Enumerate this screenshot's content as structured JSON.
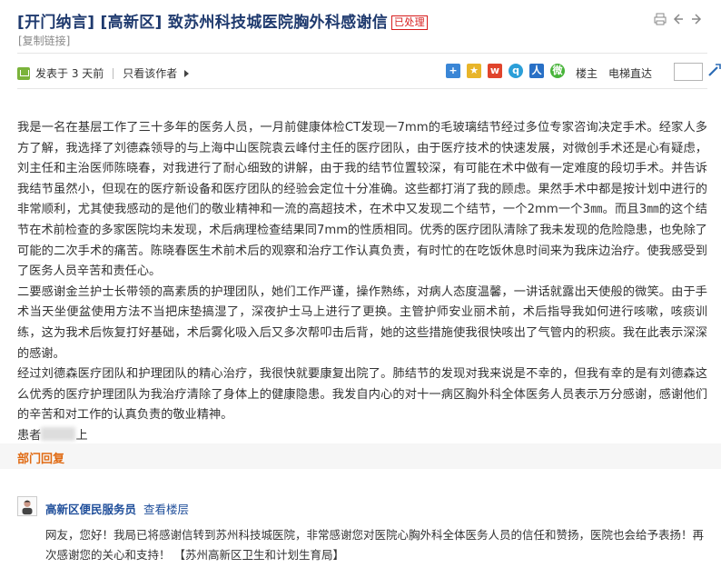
{
  "header": {
    "title": "[开门纳言] [高新区] 致苏州科技城医院胸外科感谢信",
    "status_tag": "已处理",
    "copy_link": "[复制链接]"
  },
  "meta": {
    "posted": "发表于 3 天前",
    "only_author": "只看该作者",
    "floor": "楼主",
    "elevator": "电梯直达"
  },
  "content": {
    "paragraphs": [
      "我是一名在基层工作了三十多年的医务人员，一月前健康体检CT发现一7mm的毛玻璃结节经过多位专家咨询决定手术。经家人多方了解，我选择了刘德森领导的与上海中山医院袁云峰付主任的医疗团队，由于医疗技术的快速发展，对微创手术还是心有疑虑，刘主任和主治医师陈晓春，对我进行了耐心细致的讲解，由于我的结节位置较深，有可能在术中做有一定难度的段切手术。并告诉我结节虽然小，但现在的医疗新设备和医疗团队的经验会定位十分准确。这些都打消了我的顾虑。果然手术中都是按计划中进行的非常顺利，尤其使我感动的是他们的敬业精神和一流的高超技术，在术中又发现二个结节，一个2mm一个3㎜。而且3㎜的这个结节在术前检查的多家医院均未发现，术后病理检查结果同7mm的性质相同。优秀的医疗团队清除了我未发现的危险隐患，也免除了可能的二次手术的痛苦。陈晓春医生术前术后的观察和治疗工作认真负责，有时忙的在吃饭休息时间来为我床边治疗。使我感受到了医务人员辛苦和责任心。",
      "二要感谢金兰护士长带领的高素质的护理团队，她们工作严谨，操作熟练，对病人态度温馨，一讲话就露出天使般的微笑。由于手术当天坐便盆使用方法不当把床垫搞湿了，深夜护士马上进行了更换。主管护师安业丽术前，术后指导我如何进行咳嗽，咳痰训练，这为我术后恢复打好基础，术后雾化吸入后又多次帮叩击后背，她的这些措施使我很快咳出了气管内的积痰。我在此表示深深的感谢。",
      "经过刘德森医疗团队和护理团队的精心治疗，我很快就要康复出院了。肺结节的发现对我来说是不幸的，但我有幸的是有刘德森这么优秀的医疗护理团队为我治疗清除了身体上的健康隐患。我发自内心的对十一病区胸外科全体医务人员表示万分感谢，感谢他们的辛苦和对工作的认真负责的敬业精神。"
    ],
    "signature_prefix": "患者",
    "signature_suffix": "上"
  },
  "dept_reply": {
    "label": "部门回复",
    "author": "高新区便民服务员",
    "floor_link": "查看楼层",
    "text": "网友，您好！我局已将感谢信转到苏州科技城医院，非常感谢您对医院心胸外科全体医务人员的信任和赞扬，医院也会给予表扬！再次感谢您的关心和支持！ 【苏州高新区卫生和计划生育局】"
  },
  "colors": {
    "title": "#1f3a6e",
    "status": "#d71c1c",
    "reply_label": "#e06b14",
    "link": "#1f4e9a"
  },
  "icons": [
    "print-icon",
    "prev-icon",
    "next-icon",
    "share-icons",
    "go-icon"
  ]
}
